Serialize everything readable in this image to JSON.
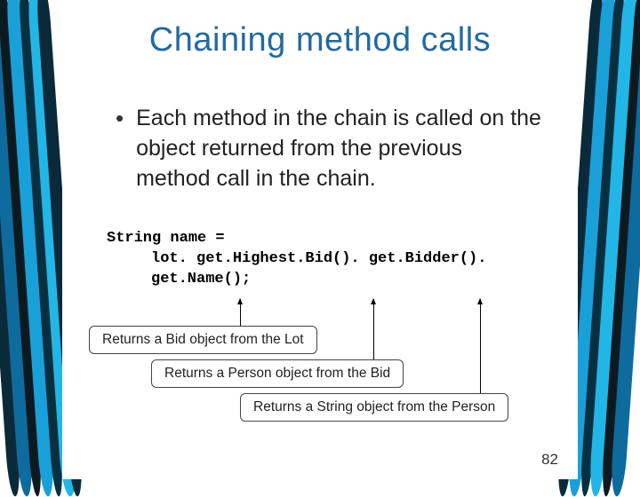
{
  "title": "Chaining method calls",
  "bullet": "Each method in the chain is called on the object returned from the previous method call in the chain.",
  "code": {
    "line1": "String name =",
    "line2": "lot. get.Highest.Bid(). get.Bidder(). get.Name();"
  },
  "callouts": [
    "Returns a Bid object from the Lot",
    "Returns a Person object from the Bid",
    "Returns a String object from the Person"
  ],
  "page_number": "82"
}
